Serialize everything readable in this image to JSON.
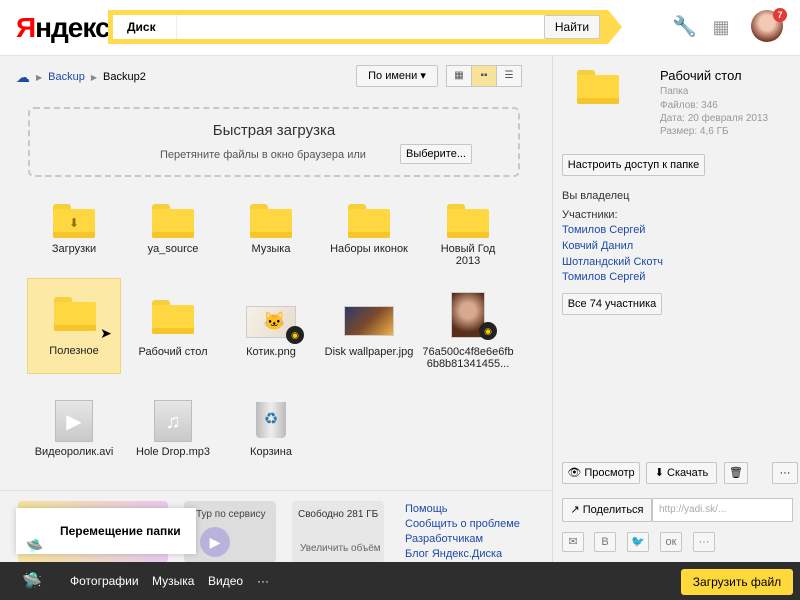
{
  "header": {
    "logo_red": "Я",
    "logo_rest": "ндекс",
    "search_tag": "Диск",
    "search_value": "",
    "search_button": "Найти",
    "wrench_icon": "wrench-icon",
    "apps_icon": "grid-icon",
    "notification_count": "7"
  },
  "breadcrumb": {
    "root": "Backup",
    "current": "Backup2"
  },
  "toolbar": {
    "sort_label": "По имени ▾"
  },
  "upload": {
    "title": "Быстрая загрузка",
    "hint": "Перетяните файлы в окно браузера или",
    "choose_button": "Выберите..."
  },
  "files": [
    {
      "label": "Загрузки"
    },
    {
      "label": "ya_source"
    },
    {
      "label": "Музыка"
    },
    {
      "label": "Наборы иконок"
    },
    {
      "label": "Новый Год\n2013"
    },
    {
      "label": "Полезное"
    },
    {
      "label": "Рабочий стол"
    },
    {
      "label": "Котик.png"
    },
    {
      "label": "Disk wallpaper.jpg"
    },
    {
      "label": "76a500c4f8e6e6fb\n6b8b81341455..."
    },
    {
      "label": "Видеоролик.avi"
    },
    {
      "label": "Hole Drop.mp3"
    },
    {
      "label": "Корзина"
    }
  ],
  "promo": {
    "tour": "Тур по сервису",
    "free": "Свободно 281 ГБ",
    "increase": "Увеличить объём",
    "links": [
      "Помощь",
      "Сообщить о проблеме",
      "Разработчикам",
      "Блог Яндекс.Диска"
    ]
  },
  "toast": {
    "text": "Перемещение папки"
  },
  "sidebar": {
    "folder_title": "Рабочий стол",
    "folder_type": "Папка",
    "files_count": "Файлов: 346",
    "date": "Дата: 20 февраля 2013",
    "size": "Размер: 4,6 ГБ",
    "access_button": "Настроить доступ к папке",
    "owner": "Вы владелец",
    "participants_label": "Участники:",
    "participants": [
      "Томилов Сергей",
      "Ковчий Данил",
      "Шотландский Скотч",
      "Томилов Сергей"
    ],
    "all_participants_button": "Все 74 участника",
    "view_button": "Просмотр",
    "download_button": "Скачать",
    "more_button": "···",
    "share_button": "Поделиться",
    "share_link": "http://yadi.sk/...",
    "social": [
      "✉",
      "В",
      "🐦",
      "ок",
      "···"
    ]
  },
  "footer": {
    "items": [
      "Фотографии",
      "Музыка",
      "Видео",
      "···"
    ],
    "upload_button": "Загрузить файл"
  },
  "colors": {
    "accent": "#ffdb4d",
    "link": "#1d4aa8",
    "footer": "#2e2e2e"
  }
}
